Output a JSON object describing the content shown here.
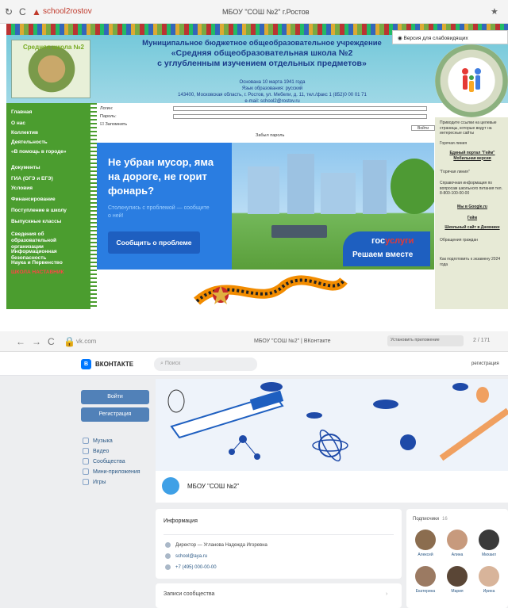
{
  "top_browser": {
    "url": "school2rostov",
    "title": "МБОУ \"СОШ №2\" г.Ростов"
  },
  "school_site": {
    "vision_button": "Версия для слабовидящих",
    "photo_label": "Средняя школа №2",
    "name_lines": [
      "Муниципальное бюджетное общеобразовательное учреждение",
      "«Средняя общеобразовательная школа №2",
      "с углубленным изучением отдельных предметов»"
    ],
    "info_lines": [
      "Основана 10 марта 1941 года",
      "Язык образования: русский",
      "143400, Московская область, г. Ростов, ул. Мебели, д. 11, тел./факс 1 (852)0 00 01 71",
      "e-mail: school2@rostov.ru"
    ],
    "sidebar": [
      {
        "label": "Главная",
        "red": false
      },
      {
        "label": "О нас",
        "red": false
      },
      {
        "label": "Коллектив",
        "red": false
      },
      {
        "label": "Деятельность",
        "red": false
      },
      {
        "label": "«В помощь в городе»",
        "red": false
      },
      {
        "label": "Документы",
        "red": false
      },
      {
        "label": "ГИА (ОГЭ и ЕГЭ)",
        "red": false
      },
      {
        "label": "Условия",
        "red": false
      },
      {
        "label": "Финансирование",
        "red": false
      },
      {
        "label": "Поступление в школу",
        "red": false
      },
      {
        "label": "Выпускные классы",
        "red": false
      },
      {
        "label": "Сведения об образовательной организации",
        "red": false
      },
      {
        "label": "Информационная безопасность",
        "red": false
      },
      {
        "label": "Наука и Первенство",
        "red": false
      },
      {
        "label": "ШКОЛА НАСТАВНИК",
        "red": true
      }
    ],
    "form": {
      "login_label": "Логин:",
      "password_label": "Пароль:",
      "remember_label": "Запомнить",
      "submit_label": "Войти",
      "register_label": "Забыл пароль"
    },
    "gos_banner": {
      "headline": "Не убран мусор, яма на дороге, не горит фонарь?",
      "subtext": "Столкнулись с проблемой — сообщите о ней!",
      "button": "Сообщить о проблеме",
      "logo_gos": "гос",
      "logo_uslugi": "услуги",
      "logo_tagline": "Решаем вместе"
    },
    "right_panel": [
      {
        "text": "Приводите ссылки на целевые страницы, которые ведут на интересные сайты",
        "link": false
      },
      {
        "text": "Горячая линия",
        "link": false
      },
      {
        "text": "Единый портал \"Гейм\" Мобильная версия",
        "link": true
      },
      {
        "text": "\"Горячая линия\"",
        "link": false
      },
      {
        "text": "Справочная информация по вопросам школьного питания тел. 8-800-100-00-00",
        "link": false
      },
      {
        "text": "Мы в Google.ru",
        "link": true
      },
      {
        "text": "Гейм",
        "link": true
      },
      {
        "text": "Школьный сайт в Дневнике",
        "link": true
      },
      {
        "text": "Обращения граждан",
        "link": false
      },
      {
        "text": "Как подготовить к экзамену 2024 года",
        "link": false
      }
    ]
  },
  "bottom_browser": {
    "url": "vk.com",
    "title": "МБОУ \"СОШ №2\" | ВКонтакте",
    "extension": "Установить приложение",
    "right": "2 / 171"
  },
  "vk": {
    "logo_text": "ВКОНТАКТЕ",
    "search_placeholder": "Поиск",
    "register_link": "регистрация",
    "login_button": "Войти",
    "signup_button": "Регистрация",
    "menu": [
      "Музыка",
      "Видео",
      "Сообщества",
      "Мини-приложения",
      "Игры"
    ],
    "group_name": "МБОУ \"СОШ №2\"",
    "info_header": "Информация",
    "info_rows": [
      {
        "text": "Директор — Угланова Надежда Игоревна",
        "link": false
      },
      {
        "text": "school@aya.ru",
        "link": true
      },
      {
        "text": "+7 (495) 000-00-00",
        "link": true
      }
    ],
    "posts_header": "Записи сообщества",
    "members_header": "Подписчики",
    "members_count": "16",
    "members": [
      {
        "name": "Алексей",
        "color": "#8b6d4f"
      },
      {
        "name": "Алина",
        "color": "#c79a7d"
      },
      {
        "name": "Михаил",
        "color": "#3a3a3a"
      },
      {
        "name": "Екатерина",
        "color": "#9b7a62"
      },
      {
        "name": "Мария",
        "color": "#5a4636"
      },
      {
        "name": "Ирина",
        "color": "#d8b49a"
      }
    ]
  }
}
